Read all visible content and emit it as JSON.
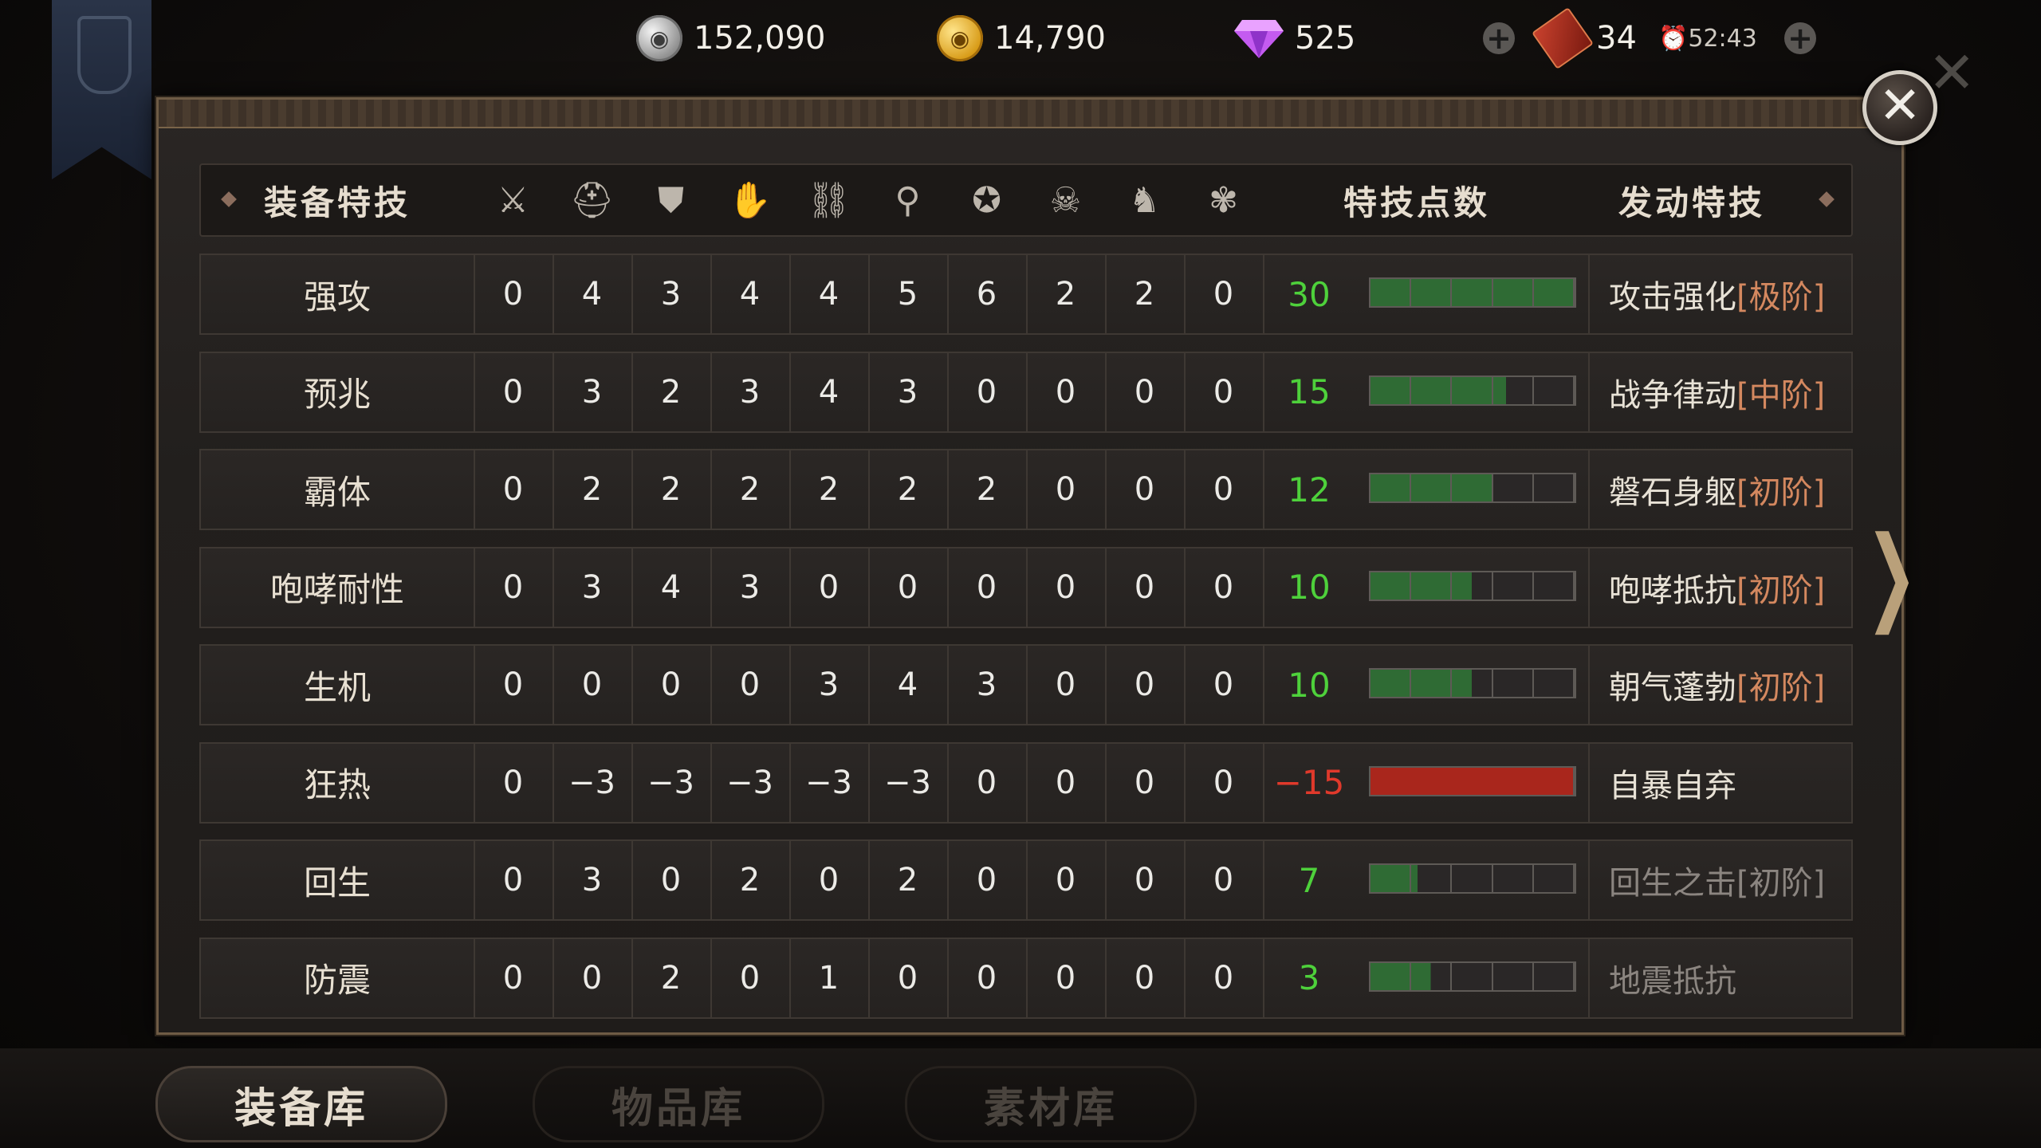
{
  "currency": {
    "silver": "152,090",
    "gold": "14,790",
    "gems": "525",
    "tickets": "34",
    "timer": "52:43"
  },
  "colors": {
    "positive": "#4ed13b",
    "negative": "#e0392b",
    "tier": "#d4885f",
    "bar_fill": "#2f6b34"
  },
  "table": {
    "header": {
      "skill_label": "装备特技",
      "slot_icons": [
        "sword-icon",
        "helmet-icon",
        "chest-armor-icon",
        "arm-armor-icon",
        "waist-armor-icon",
        "leg-armor-icon",
        "charm-icon",
        "mask-icon",
        "horse-icon",
        "kinsect-icon"
      ],
      "points_label": "特技点数",
      "active_label": "发动特技"
    },
    "rows": [
      {
        "name": "强攻",
        "values": [
          "0",
          "4",
          "3",
          "4",
          "4",
          "5",
          "6",
          "2",
          "2",
          "0"
        ],
        "total": "30",
        "fill": 1.0,
        "segments": 5,
        "negative": false,
        "active": "攻击强化",
        "tier": "[极阶]",
        "dim": false
      },
      {
        "name": "预兆",
        "values": [
          "0",
          "3",
          "2",
          "3",
          "4",
          "3",
          "0",
          "0",
          "0",
          "0"
        ],
        "total": "15",
        "fill": 0.666,
        "segments": 3,
        "negative": false,
        "active": "战争律动",
        "tier": "[中阶]",
        "dim": false
      },
      {
        "name": "霸体",
        "values": [
          "0",
          "2",
          "2",
          "2",
          "2",
          "2",
          "2",
          "0",
          "0",
          "0"
        ],
        "total": "12",
        "fill": 0.6,
        "segments": 2,
        "negative": false,
        "active": "磐石身躯",
        "tier": "[初阶]",
        "dim": false
      },
      {
        "name": "咆哮耐性",
        "values": [
          "0",
          "3",
          "4",
          "3",
          "0",
          "0",
          "0",
          "0",
          "0",
          "0"
        ],
        "total": "10",
        "fill": 0.5,
        "segments": 2,
        "negative": false,
        "active": "咆哮抵抗",
        "tier": "[初阶]",
        "dim": false
      },
      {
        "name": "生机",
        "values": [
          "0",
          "0",
          "0",
          "0",
          "3",
          "4",
          "3",
          "0",
          "0",
          "0"
        ],
        "total": "10",
        "fill": 0.5,
        "segments": 2,
        "negative": false,
        "active": "朝气蓬勃",
        "tier": "[初阶]",
        "dim": false
      },
      {
        "name": "狂热",
        "values": [
          "0",
          "−3",
          "−3",
          "−3",
          "−3",
          "−3",
          "0",
          "0",
          "0",
          "0"
        ],
        "total": "−15",
        "fill": 1.0,
        "segments": 1,
        "negative": true,
        "active": "自暴自弃",
        "tier": "",
        "dim": false
      },
      {
        "name": "回生",
        "values": [
          "0",
          "3",
          "0",
          "2",
          "0",
          "2",
          "0",
          "0",
          "0",
          "0"
        ],
        "total": "7",
        "fill": 0.233,
        "segments": 3,
        "negative": false,
        "active": "回生之击",
        "tier": "[初阶]",
        "dim": true
      },
      {
        "name": "防震",
        "values": [
          "0",
          "0",
          "2",
          "0",
          "1",
          "0",
          "0",
          "0",
          "0",
          "0"
        ],
        "total": "3",
        "fill": 0.3,
        "segments": 1,
        "negative": false,
        "active": "地震抵抗",
        "tier": "",
        "dim": true
      }
    ]
  },
  "tabs": [
    {
      "label": "装备库",
      "active": true
    },
    {
      "label": "物品库",
      "active": false
    },
    {
      "label": "素材库",
      "active": false
    }
  ]
}
